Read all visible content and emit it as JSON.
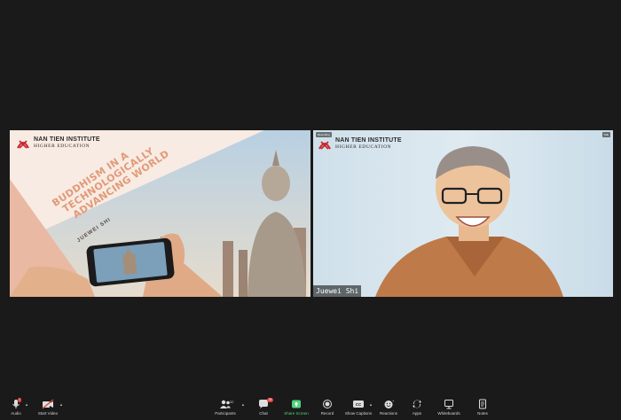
{
  "slide": {
    "logo_line1": "NAN TIEN INSTITUTE",
    "logo_line2": "HIGHER EDUCATION",
    "title_lines": [
      "BUDDHISM IN A",
      "TECHNOLOGICALLY",
      "ADVANCING WORLD"
    ],
    "presenter": "JUEWEI SHI"
  },
  "camera": {
    "logo_line1": "NAN TIEN INSTITUTE",
    "logo_line2": "HIGHER EDUCATION",
    "participant_name": "Juewei Shi",
    "recording_badge": "Recording",
    "corner_badge": "Talk"
  },
  "toolbar": {
    "audio": "Audio",
    "video": "Start Video",
    "participants": "Participants",
    "participants_count": "32",
    "chat": "Chat",
    "chat_badge": "24",
    "share": "Share Screen",
    "record": "Record",
    "captions": "Show Captions",
    "reactions": "Reactions",
    "apps": "Apps",
    "whiteboards": "Whiteboards",
    "notes": "Notes"
  },
  "colors": {
    "background": "#1a1a1a",
    "share_green": "#4fd37c",
    "slide_title": "#e29a78",
    "badge_red": "#e0433c"
  }
}
